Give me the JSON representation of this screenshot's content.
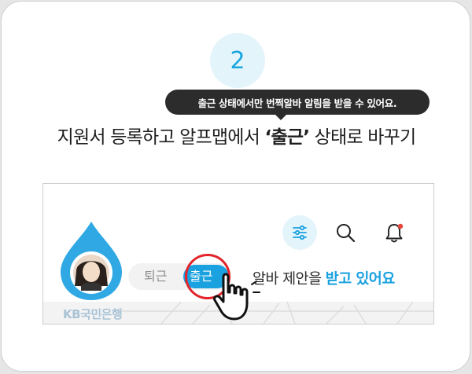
{
  "step": {
    "number": "2"
  },
  "tooltip": {
    "text": "출근 상태에서만 번쩍알바 알림을 받을 수 있어요."
  },
  "headline": {
    "prefix": "지원서 등록하고 알프맵에서 ",
    "highlight": "‘출근’",
    "suffix": " 상태로 바꾸기"
  },
  "app": {
    "bank_name": "KB국민은행",
    "toggle": {
      "off_label": "퇴근",
      "on_label": "출근",
      "selected": "출근"
    },
    "offer": {
      "prefix": "알바 제안을 ",
      "highlight": "받고 있어요"
    },
    "icons": [
      "filter-icon",
      "search-icon",
      "bell-icon"
    ]
  },
  "colors": {
    "accent": "#1aa1e0",
    "highlight_ring": "#e3242b",
    "notification_dot": "#e8453c",
    "tooltip_bg": "#2c2c2c"
  }
}
